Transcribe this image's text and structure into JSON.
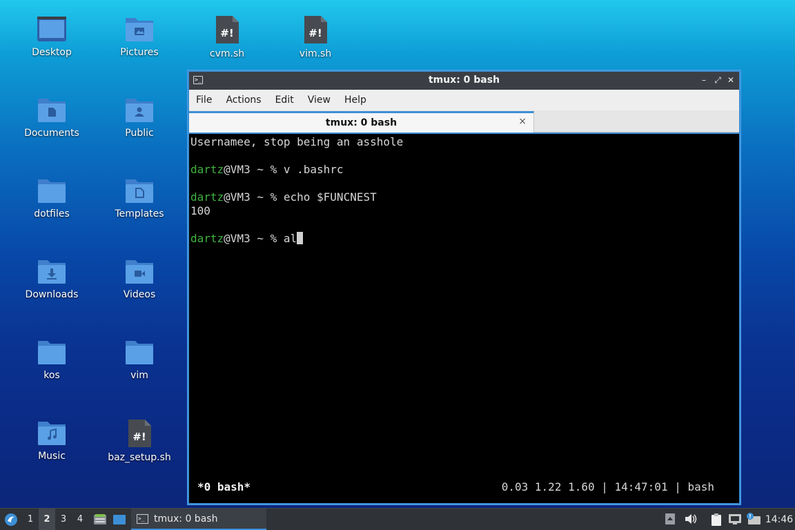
{
  "desktop": {
    "icons": [
      {
        "label": "Desktop",
        "type": "desktop-folder"
      },
      {
        "label": "Pictures",
        "type": "pictures-folder"
      },
      {
        "label": "cvm.sh",
        "type": "script-file"
      },
      {
        "label": "vim.sh",
        "type": "script-file"
      },
      {
        "label": "Documents",
        "type": "documents-folder"
      },
      {
        "label": "Public",
        "type": "public-folder"
      },
      {
        "label": "dotfiles",
        "type": "folder"
      },
      {
        "label": "Templates",
        "type": "templates-folder"
      },
      {
        "label": "Downloads",
        "type": "downloads-folder"
      },
      {
        "label": "Videos",
        "type": "videos-folder"
      },
      {
        "label": "kos",
        "type": "folder"
      },
      {
        "label": "vim",
        "type": "folder"
      },
      {
        "label": "Music",
        "type": "music-folder"
      },
      {
        "label": "baz_setup.sh",
        "type": "script-file"
      }
    ]
  },
  "window": {
    "title": "tmux: 0 bash",
    "menu": [
      "File",
      "Actions",
      "Edit",
      "View",
      "Help"
    ],
    "tab": {
      "label": "tmux: 0 bash",
      "close": "×"
    },
    "controls": {
      "minimize": "–",
      "maximize": "⤢",
      "close": "✕"
    }
  },
  "terminal": {
    "lines": [
      {
        "text": "Usernamee, stop being an asshole"
      },
      {
        "user": "dartz",
        "rest": "@VM3 ~ % v .bashrc"
      },
      {
        "user": "dartz",
        "rest": "@VM3 ~ % echo $FUNCNEST"
      },
      {
        "text": "100"
      },
      {
        "user": "dartz",
        "rest": "@VM3 ~ % al"
      }
    ],
    "status_left": "*0 bash*",
    "status_right": "0.03 1.22 1.60 | 14:47:01 | bash"
  },
  "taskbar": {
    "workspaces": [
      "1",
      "2",
      "3",
      "4"
    ],
    "active_workspace": "2",
    "task_label": "tmux: 0 bash",
    "clock": "14:46"
  },
  "colors": {
    "accent": "#3c8fd6",
    "prompt_user": "#3fb23f",
    "folder": "#5aa0e6"
  }
}
